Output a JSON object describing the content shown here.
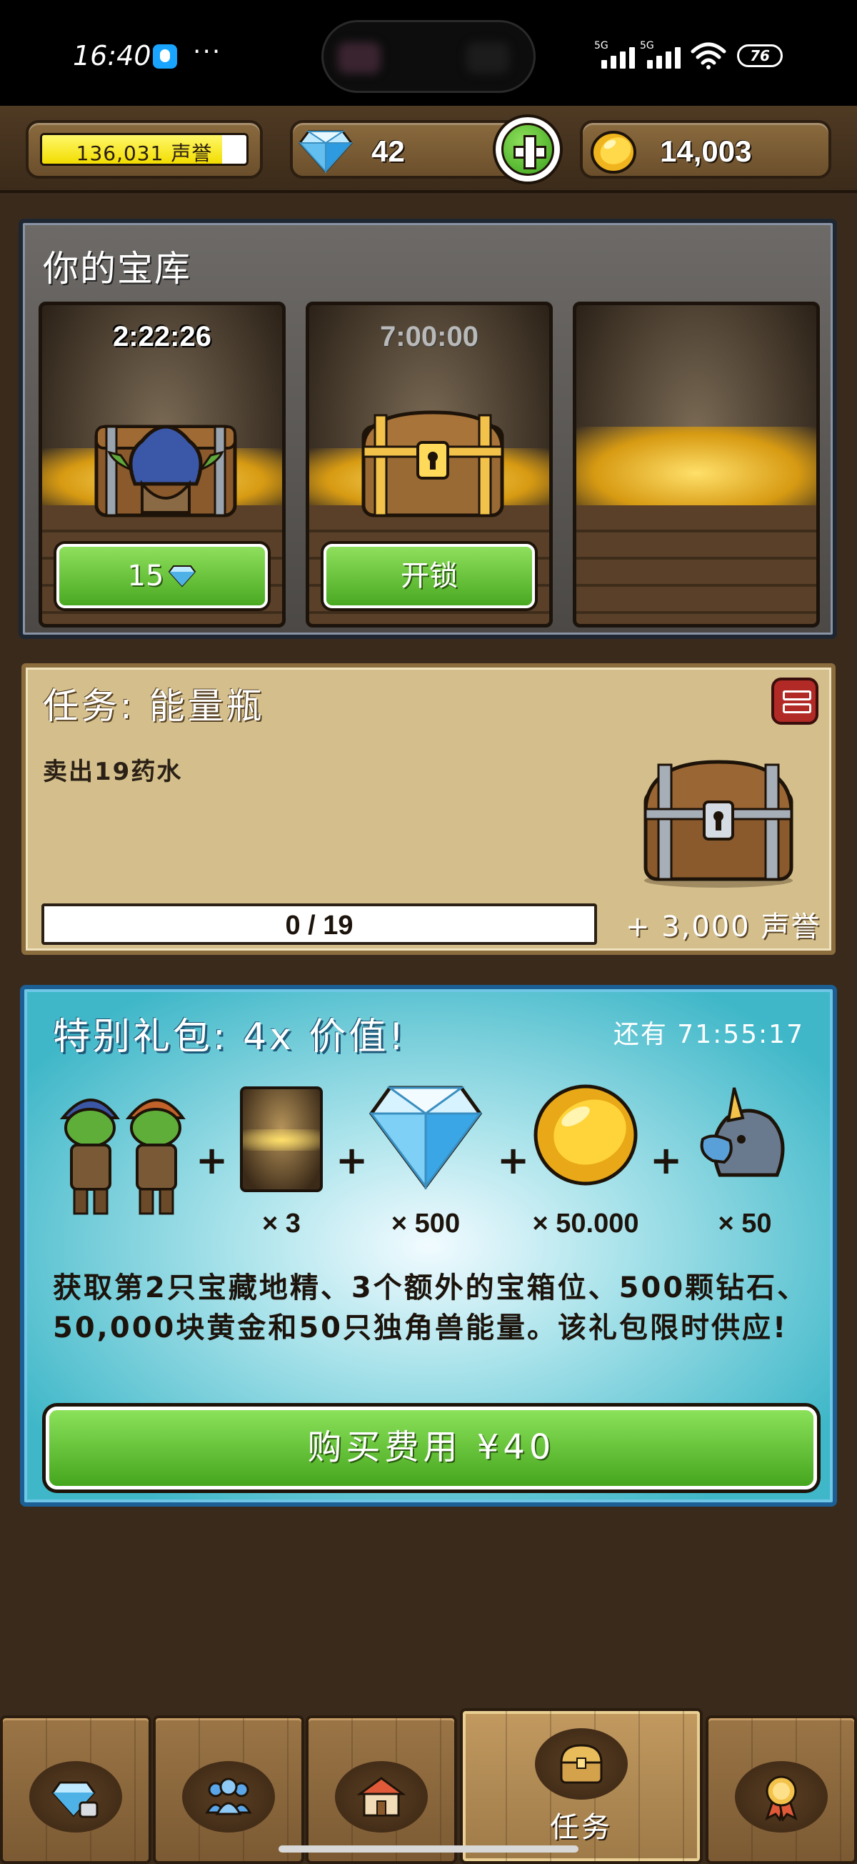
{
  "status_bar": {
    "time": "16:40",
    "dots": "···",
    "signal_label_1": "5G",
    "signal_label_2": "5G",
    "battery": "76"
  },
  "resources": {
    "reputation": "136,031 声誉",
    "reputation_fill": 0.88,
    "gems": "42",
    "gold": "14,003"
  },
  "vault": {
    "title": "你的宝库",
    "slots": [
      {
        "timer": "2:22:26",
        "button_label": "15",
        "button_icon": "gem-icon",
        "content": "goblin-in-chest"
      },
      {
        "timer": "7:00:00",
        "button_label": "开锁",
        "content": "gold-chest"
      },
      {
        "timer": "",
        "button_label": "",
        "content": "empty"
      }
    ]
  },
  "mission": {
    "title": "任务: 能量瓶",
    "description": "卖出19药水",
    "progress_text": "0 / 19",
    "progress_fraction": 0,
    "reward": "+ 3,000 声誉"
  },
  "offer": {
    "title": "特别礼包: 4x 价值!",
    "timer": "还有 71:55:17",
    "items": [
      {
        "icon": "goblins-icon",
        "qty": ""
      },
      {
        "icon": "chest-slot-icon",
        "qty": "× 3"
      },
      {
        "icon": "diamond-icon",
        "qty": "× 500"
      },
      {
        "icon": "gold-coin-icon",
        "qty": "× 50.000"
      },
      {
        "icon": "unicorn-icon",
        "qty": "× 50"
      }
    ],
    "plus_sign": "+",
    "description": "获取第2只宝藏地精、3个额外的宝箱位、500颗钻石、50,000块黄金和50只独角兽能量。该礼包限时供应!",
    "buy_label": "购买费用 ¥40"
  },
  "nav": {
    "tabs": [
      {
        "icon": "gem-shop-icon",
        "label": ""
      },
      {
        "icon": "people-icon",
        "label": ""
      },
      {
        "icon": "house-icon",
        "label": ""
      },
      {
        "icon": "chest-icon",
        "label": "任务",
        "active": true
      },
      {
        "icon": "medal-icon",
        "label": ""
      }
    ]
  },
  "colors": {
    "accent_green": "#49a821",
    "offer_blue": "#1b5f95",
    "parchment": "#d4bf8c",
    "reputation_yellow": "#f2dc00"
  }
}
